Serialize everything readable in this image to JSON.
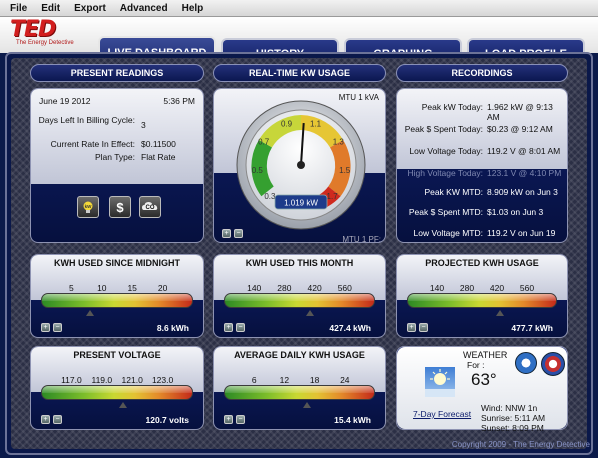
{
  "menu": [
    "File",
    "Edit",
    "Export",
    "Advanced",
    "Help"
  ],
  "logo": {
    "text": "TED",
    "tagline": "The Energy Detective"
  },
  "tabs": [
    "LIVE DASHBOARD",
    "HISTORY",
    "GRAPHING",
    "LOAD PROFILE"
  ],
  "present_readings": {
    "title": "PRESENT READINGS",
    "date": "June 19 2012",
    "time": "5:36 PM",
    "days_left_label": "Days Left In Billing Cycle:",
    "days_left": "3",
    "rate_label": "Current Rate In Effect:",
    "rate": "$0.11500",
    "plan_label": "Plan Type:",
    "plan": "Flat Rate",
    "icons": [
      "bulb-icon",
      "dollar-icon",
      "co2-icon"
    ],
    "dollar_symbol": "$",
    "co2_symbol": "CO"
  },
  "realtime": {
    "title": "REAL-TIME KW USAGE",
    "mtu_top": "MTU 1 kVA",
    "mtu_bottom": "MTU 1 PF:",
    "dial_labels": [
      "0.3",
      "0.5",
      "0.7",
      "0.9",
      "1.1",
      "1.3",
      "1.5",
      "1.7"
    ],
    "value_text": "1.019 kW",
    "value": 1.019
  },
  "recordings": {
    "title": "RECORDINGS",
    "rows": [
      {
        "label": "Peak kW Today:",
        "value": "1.962 kW @ 9:13 AM"
      },
      {
        "label": "Peak $ Spent Today:",
        "value": "$0.23 @ 9:12 AM"
      },
      {
        "label": "Low Voltage Today:",
        "value": "119.2 V @ 8:01 AM"
      },
      {
        "label": "High Voltage Today:",
        "value": "123.1 V @ 4:10 PM"
      },
      {
        "label": "Peak KW MTD:",
        "value": "8.909 kW on Jun 3"
      },
      {
        "label": "Peak $ Spent MTD:",
        "value": "$1.03 on Jun 3"
      },
      {
        "label": "Low Voltage MTD:",
        "value": "119.2 V on Jun 19"
      },
      {
        "label": "High Voltage MTD:",
        "value": "122.7 V on Jun 15"
      }
    ]
  },
  "kwh_midnight": {
    "title": "KWH USED SINCE MIDNIGHT",
    "ticks": [
      "5",
      "10",
      "15",
      "20"
    ],
    "value_text": "8.6 kWh",
    "level": 0.32
  },
  "kwh_month": {
    "title": "KWH USED THIS MONTH",
    "ticks": [
      "140",
      "280",
      "420",
      "560"
    ],
    "value_text": "427.4 kWh",
    "level": 0.57
  },
  "kwh_projected": {
    "title": "PROJECTED KWH USAGE",
    "ticks": [
      "140",
      "280",
      "420",
      "560"
    ],
    "value_text": "477.7 kWh",
    "level": 0.62
  },
  "voltage": {
    "title": "PRESENT VOLTAGE",
    "ticks": [
      "117.0",
      "119.0",
      "121.0",
      "123.0"
    ],
    "value_text": "120.7 volts",
    "level": 0.54
  },
  "avg_daily": {
    "title": "AVERAGE DAILY KWH USAGE",
    "ticks": [
      "6",
      "12",
      "18",
      "24"
    ],
    "value_text": "15.4 kWh",
    "level": 0.55
  },
  "weather": {
    "title": "WEATHER",
    "for_label": "For :",
    "temp": "63°",
    "forecast_link": "7-Day Forecast",
    "wind": "Wind: NNW 1n",
    "sunrise": "Sunrise: 5:11 AM",
    "sunset": "Sunset: 8:09 PM"
  },
  "copyright": "Copyright 2009 - The Energy Detective",
  "colors": {
    "accent": "#d21e1e",
    "panel": "#0f1f6a"
  }
}
